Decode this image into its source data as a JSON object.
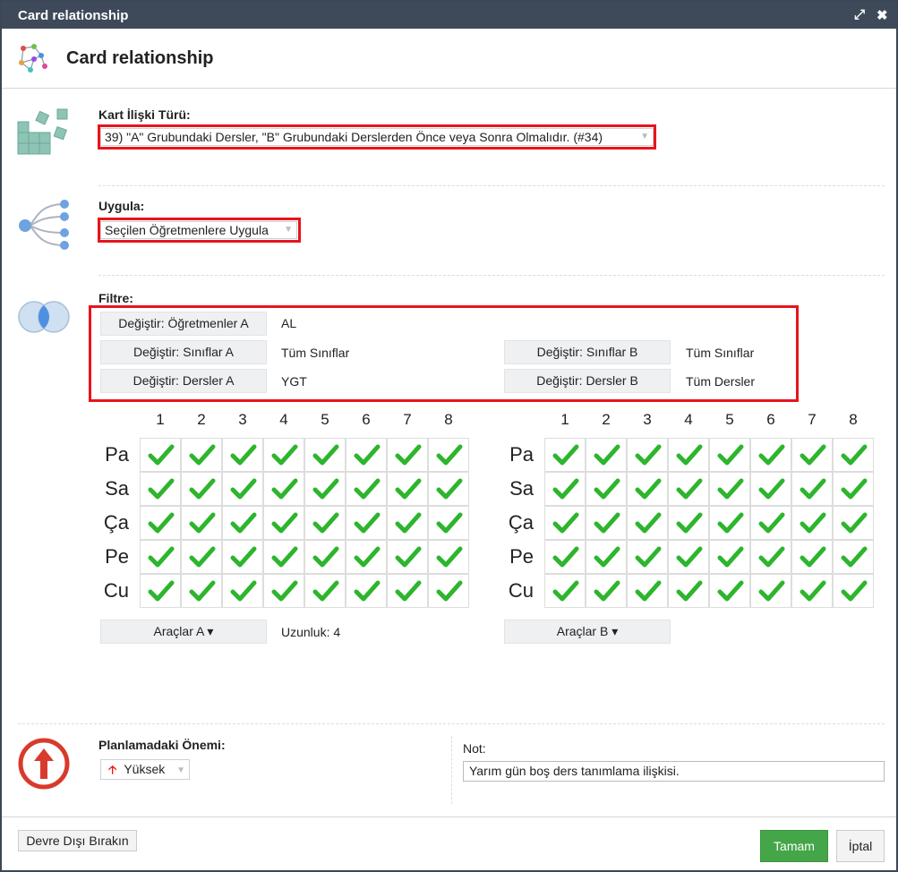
{
  "window": {
    "title": "Card relationship"
  },
  "header": {
    "title": "Card relationship"
  },
  "relation_type": {
    "label": "Kart İlişki Türü:",
    "value": "39) \"A\" Grubundaki Dersler, \"B\" Grubundaki Derslerden Önce veya Sonra Olmalıdır. (#34)"
  },
  "apply": {
    "label": "Uygula:",
    "value": "Seçilen Öğretmenlere Uygula"
  },
  "filter": {
    "label": "Filtre:",
    "teachers_a": {
      "button": "Değiştir: Öğretmenler A",
      "value": "AL"
    },
    "classes_a": {
      "button": "Değiştir: Sınıflar A",
      "value": "Tüm Sınıflar"
    },
    "lessons_a": {
      "button": "Değiştir: Dersler A",
      "value": "YGT"
    },
    "classes_b": {
      "button": "Değiştir: Sınıflar B",
      "value": "Tüm Sınıflar"
    },
    "lessons_b": {
      "button": "Değiştir: Dersler B",
      "value": "Tüm Dersler"
    }
  },
  "grid": {
    "periods": [
      "1",
      "2",
      "3",
      "4",
      "5",
      "6",
      "7",
      "8"
    ],
    "days": [
      "Pa",
      "Sa",
      "Ça",
      "Pe",
      "Cu"
    ],
    "check_color": "#2db52d"
  },
  "tools_a": {
    "label": "Araçlar A ▾",
    "length_text": "Uzunluk: 4"
  },
  "tools_b": {
    "label": "Araçlar B ▾"
  },
  "importance": {
    "label": "Planlamadaki Önemi:",
    "value": "Yüksek",
    "icon": "up-arrow-icon",
    "color": "#d93a2b"
  },
  "note": {
    "label": "Not:",
    "value": "Yarım gün boş ders tanımlama ilişkisi."
  },
  "footer": {
    "disable": "Devre Dışı Bırakın",
    "ok": "Tamam",
    "cancel": "İptal",
    "ok_color": "#44a648"
  }
}
